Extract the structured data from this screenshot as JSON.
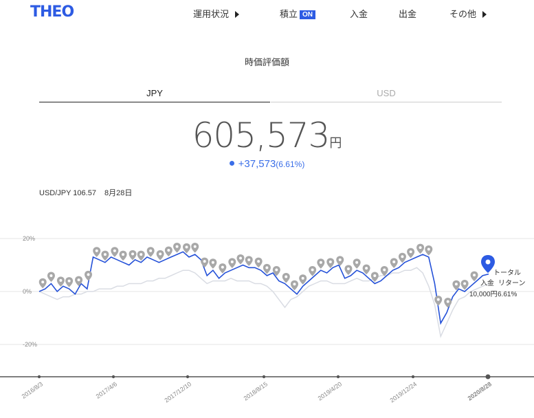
{
  "header": {
    "logo": "THEO",
    "nav": [
      {
        "label": "運用状況"
      },
      {
        "label": "積立",
        "badge": "ON"
      },
      {
        "label": "入金"
      },
      {
        "label": "出金"
      },
      {
        "label": "その他"
      }
    ]
  },
  "title": "時価評価額",
  "tabs": {
    "jpy": "JPY",
    "usd": "USD"
  },
  "amount": {
    "value": "605,573",
    "unit": "円"
  },
  "change": {
    "value": "+37,573",
    "pct": "(6.61%)"
  },
  "rate": {
    "label": "USD/JPY 106.57",
    "date": "8月28日"
  },
  "colors": {
    "accent": "#2d5be3",
    "series": "#2350d8",
    "benchmark": "#d9dce3",
    "pin": "#a8a8a8"
  },
  "chart_data": {
    "type": "line",
    "y_ticks": [
      "20%",
      "0%",
      "-20%"
    ],
    "ylim": [
      -0.3,
      0.25
    ],
    "x_ticks": [
      "2016/8/3",
      "2017/4/6",
      "2017/12/10",
      "2018/8/15",
      "2019/4/20",
      "2019/12/24",
      "2020/8/28"
    ],
    "grid": true,
    "series": [
      {
        "values": [
          0.0,
          0.01,
          0.03,
          0.0,
          0.02,
          0.01,
          -0.01,
          0.03,
          0.01,
          0.13,
          0.12,
          0.11,
          0.13,
          0.12,
          0.11,
          0.1,
          0.12,
          0.11,
          0.13,
          0.12,
          0.11,
          0.12,
          0.13,
          0.14,
          0.15,
          0.13,
          0.14,
          0.12,
          0.06,
          0.08,
          0.05,
          0.07,
          0.08,
          0.09,
          0.1,
          0.09,
          0.09,
          0.08,
          0.06,
          0.07,
          0.04,
          0.03,
          0.01,
          -0.01,
          0.02,
          0.04,
          0.06,
          0.08,
          0.07,
          0.09,
          0.1,
          0.05,
          0.06,
          0.08,
          0.07,
          0.05,
          0.03,
          0.04,
          0.06,
          0.08,
          0.09,
          0.11,
          0.12,
          0.13,
          0.14,
          0.13,
          0.03,
          -0.12,
          -0.08,
          -0.02,
          0.01,
          0.0,
          0.02,
          0.04,
          0.06,
          0.066
        ]
      },
      {
        "values": [
          0.0,
          -0.01,
          -0.02,
          -0.03,
          -0.02,
          -0.02,
          -0.01,
          -0.01,
          0.0,
          0.0,
          0.01,
          0.01,
          0.01,
          0.02,
          0.02,
          0.03,
          0.03,
          0.03,
          0.04,
          0.04,
          0.05,
          0.05,
          0.06,
          0.07,
          0.08,
          0.08,
          0.07,
          0.05,
          0.03,
          0.04,
          0.04,
          0.04,
          0.05,
          0.04,
          0.04,
          0.04,
          0.03,
          0.03,
          0.02,
          0.0,
          -0.03,
          -0.06,
          -0.03,
          -0.02,
          0.0,
          0.02,
          0.03,
          0.04,
          0.04,
          0.03,
          0.03,
          0.03,
          0.04,
          0.05,
          0.04,
          0.04,
          0.05,
          0.06,
          0.06,
          0.07,
          0.07,
          0.08,
          0.08,
          0.09,
          0.07,
          0.02,
          -0.05,
          -0.17,
          -0.12,
          -0.07,
          -0.03,
          -0.02,
          0.0,
          0.01,
          0.02,
          0.03
        ]
      }
    ],
    "pins": [
      0.6,
      2.0,
      3.6,
      5.0,
      6.6,
      8.2,
      9.6,
      11.0,
      12.6,
      14.0,
      15.6,
      17.0,
      18.6,
      20.2,
      21.6,
      23.0,
      24.6,
      26.0,
      27.6,
      29.0,
      30.6,
      32.2,
      33.6,
      35.0,
      36.6,
      38.0,
      39.6,
      41.2,
      42.6,
      44.0,
      45.6,
      47.0,
      48.6,
      50.2,
      51.6,
      53.0,
      54.6,
      56.0,
      57.6,
      59.2,
      60.6,
      62.0,
      63.6,
      65.0,
      66.6,
      68.2,
      69.6,
      71.0,
      72.6
    ],
    "annotations": [
      "トータル",
      "リターン",
      "入金",
      "10,000円",
      "6.61%"
    ]
  }
}
